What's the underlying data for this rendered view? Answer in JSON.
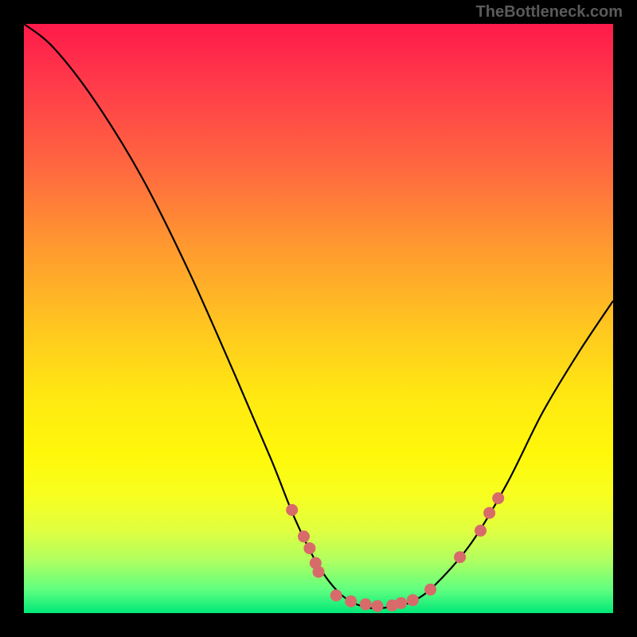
{
  "watermark": "TheBottleneck.com",
  "chart_data": {
    "type": "line",
    "title": "",
    "xlabel": "",
    "ylabel": "",
    "xlim": [
      0,
      100
    ],
    "ylim": [
      0,
      100
    ],
    "curve": [
      {
        "x": 0,
        "y": 100
      },
      {
        "x": 5,
        "y": 96
      },
      {
        "x": 12,
        "y": 87
      },
      {
        "x": 20,
        "y": 74
      },
      {
        "x": 28,
        "y": 58
      },
      {
        "x": 36,
        "y": 40
      },
      {
        "x": 42,
        "y": 26
      },
      {
        "x": 46,
        "y": 16
      },
      {
        "x": 50,
        "y": 8
      },
      {
        "x": 54,
        "y": 3
      },
      {
        "x": 58,
        "y": 1
      },
      {
        "x": 62,
        "y": 1
      },
      {
        "x": 66,
        "y": 2
      },
      {
        "x": 70,
        "y": 5
      },
      {
        "x": 76,
        "y": 12
      },
      {
        "x": 82,
        "y": 22
      },
      {
        "x": 88,
        "y": 34
      },
      {
        "x": 94,
        "y": 44
      },
      {
        "x": 100,
        "y": 53
      }
    ],
    "points": [
      {
        "x": 45.5,
        "y": 17.5
      },
      {
        "x": 47.5,
        "y": 13
      },
      {
        "x": 48.5,
        "y": 11
      },
      {
        "x": 49.5,
        "y": 8.5
      },
      {
        "x": 50,
        "y": 7
      },
      {
        "x": 53,
        "y": 3
      },
      {
        "x": 55.5,
        "y": 2
      },
      {
        "x": 58,
        "y": 1.5
      },
      {
        "x": 60,
        "y": 1.2
      },
      {
        "x": 62.5,
        "y": 1.3
      },
      {
        "x": 64,
        "y": 1.7
      },
      {
        "x": 66,
        "y": 2.2
      },
      {
        "x": 69,
        "y": 4
      },
      {
        "x": 74,
        "y": 9.5
      },
      {
        "x": 77.5,
        "y": 14
      },
      {
        "x": 79,
        "y": 17
      },
      {
        "x": 80.5,
        "y": 19.5
      }
    ]
  }
}
